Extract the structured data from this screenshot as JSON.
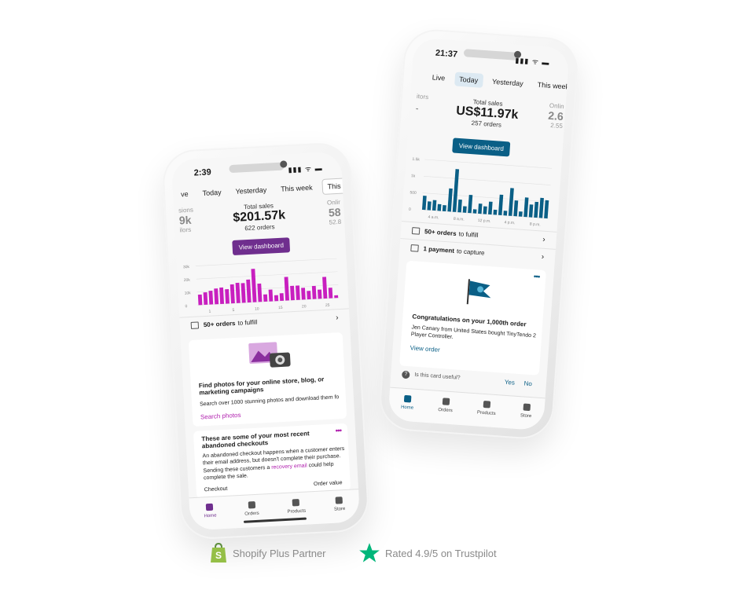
{
  "back_phone": {
    "time": "21:37",
    "status_icons": "▮▮▮ ᯤ ▬",
    "tabs": [
      "Live",
      "Today",
      "Yesterday",
      "This week",
      "This"
    ],
    "active_tab": "Today",
    "left_label": "itors",
    "left_value": "-",
    "metric": {
      "label": "Total sales",
      "value": "US$11.97k",
      "sub": "257 orders"
    },
    "right_label": "Onlin",
    "right_value": "2.6",
    "right_sub": "2.55",
    "button": "View dashboard",
    "accent": "#0a5f86",
    "row1": {
      "bold": "50+ orders",
      "text": "to fulfill"
    },
    "row2": {
      "bold": "1 payment",
      "text": "to capture"
    },
    "card": {
      "title": "Congratulations on your 1,000th order",
      "body": "Jen Canary from United States bought TinyTendo 2 Player Controller.",
      "link": "View order",
      "question": "Is this card useful?",
      "yes": "Yes",
      "no": "No"
    },
    "nav": [
      "Home",
      "Orders",
      "Products",
      "Store"
    ],
    "chart_data": {
      "type": "bar",
      "x_ticks": [
        "4 a.m.",
        "8 a.m.",
        "12 p.m.",
        "4 p.m.",
        "8 p.m."
      ],
      "y_ticks": [
        "1.5k",
        "1k",
        "500",
        "0"
      ],
      "values": [
        420,
        260,
        310,
        200,
        180,
        690,
        1280,
        380,
        190,
        540,
        120,
        300,
        230,
        380,
        150,
        610,
        140,
        830,
        470,
        150,
        580,
        380,
        470,
        600,
        540
      ],
      "color": "#0a5f86"
    }
  },
  "front_phone": {
    "time": "2:39",
    "status_icons": "▮▮▮ ᯤ ▬",
    "tabs": [
      "ve",
      "Today",
      "Yesterday",
      "This week",
      "This month"
    ],
    "active_tab": "This month",
    "left_label": "sions",
    "left_value": "9k",
    "left_sub": "ilors",
    "metric": {
      "label": "Total sales",
      "value": "$201.57k",
      "sub": "622 orders"
    },
    "right_label": "Onlir",
    "right_value": "58",
    "right_sub": "52.8",
    "button": "View dashboard",
    "accent": "#6f2e8e",
    "row1": {
      "bold": "50+ orders",
      "text": "to fulfill"
    },
    "card1": {
      "title": "Find photos for your online store, blog, or marketing campaigns",
      "body": "Search over 1000 stunning photos and download them fo",
      "link": "Search photos"
    },
    "card2": {
      "title": "These are some of your most recent abandoned checkouts",
      "body_before": "An abandoned checkout happens when a customer enters their email address, but doesn't complete their purchase. Sending these customers a",
      "body_link": "recovery email",
      "body_after": "could help complete the sale.",
      "col1": "Checkout",
      "col2": "Order value"
    },
    "nav": [
      "Home",
      "Orders",
      "Products",
      "Store"
    ],
    "chart_data": {
      "type": "bar",
      "x_ticks": [
        "1",
        "5",
        "10",
        "15",
        "20",
        "25"
      ],
      "y_ticks": [
        "30k",
        "20k",
        "10k",
        "0"
      ],
      "values": [
        8000,
        9500,
        10500,
        12000,
        12500,
        11000,
        14500,
        15500,
        15000,
        17500,
        25500,
        14000,
        5500,
        9000,
        4500,
        5800,
        18000,
        11000,
        11000,
        9000,
        6500,
        10000,
        7000,
        16500,
        8000,
        2000
      ],
      "color": "#c81fbf"
    }
  },
  "badges": {
    "shopify": "Shopify Plus Partner",
    "trustpilot": "Rated 4.9/5 on Trustpilot",
    "shopify_color": "#95bf47",
    "star_color": "#00b67a"
  }
}
